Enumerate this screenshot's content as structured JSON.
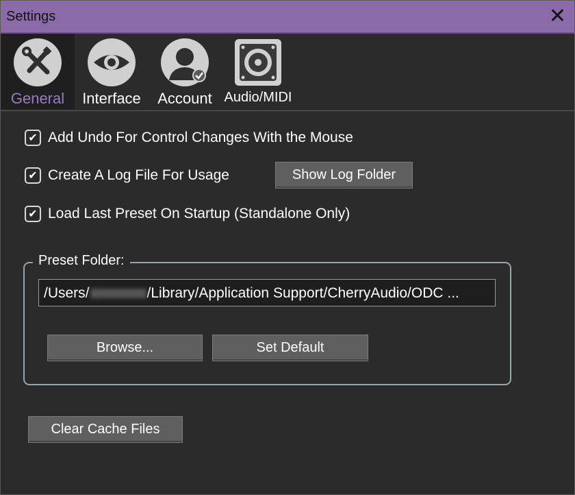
{
  "window": {
    "title": "Settings"
  },
  "tabs": [
    {
      "label": "General",
      "icon": "wrench-screwdriver-icon",
      "active": true
    },
    {
      "label": "Interface",
      "icon": "eye-icon",
      "active": false
    },
    {
      "label": "Account",
      "icon": "user-account-icon",
      "active": false
    },
    {
      "label": "Audio/MIDI",
      "icon": "speaker-icon",
      "active": false
    }
  ],
  "options": {
    "undo_label": "Add Undo For Control Changes With the Mouse",
    "undo_checked": true,
    "log_label": "Create A Log File For Usage",
    "log_checked": true,
    "show_log_folder_label": "Show Log Folder",
    "load_last_label": "Load Last Preset On Startup (Standalone Only)",
    "load_last_checked": true
  },
  "preset_folder": {
    "title": "Preset Folder:",
    "path_prefix": "/Users/",
    "path_suffix": "/Library/Application Support/CherryAudio/ODC ...",
    "browse_label": "Browse...",
    "set_default_label": "Set Default"
  },
  "clear_cache_label": "Clear Cache Files",
  "colors": {
    "titlebar": "#8a6aa8",
    "active_tab_text": "#9b7cc0",
    "background": "#2b2b2b"
  }
}
